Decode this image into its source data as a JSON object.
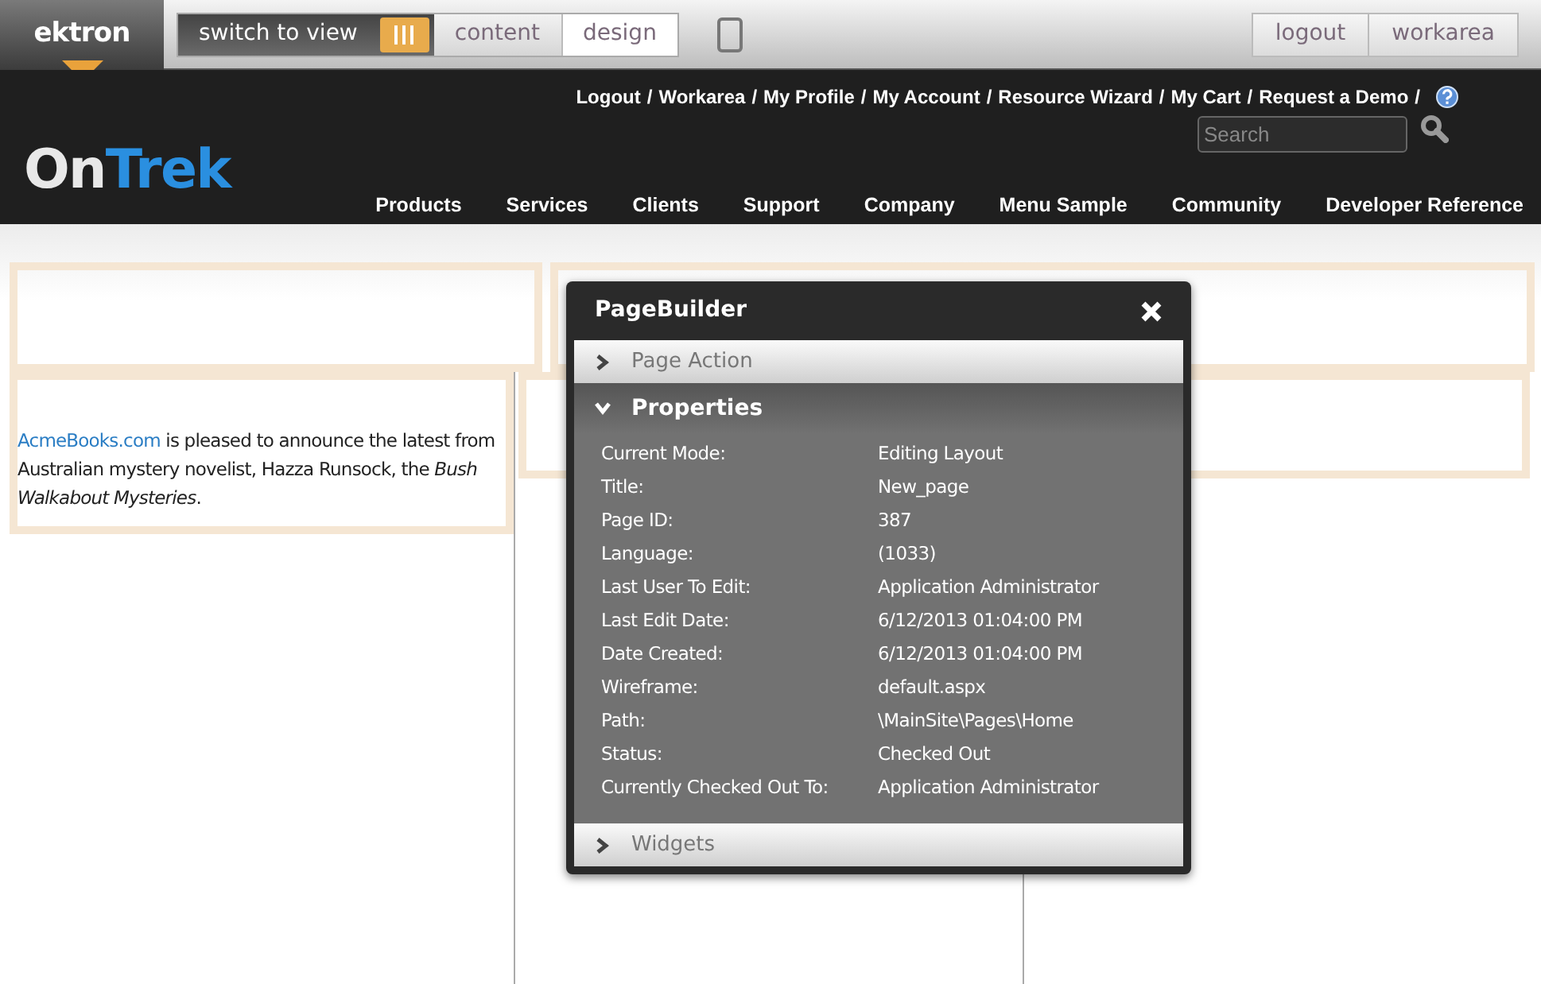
{
  "toolbar": {
    "logo": "ektron",
    "switch_label": "switch to view",
    "modes": [
      {
        "label": "content",
        "selected": false
      },
      {
        "label": "design",
        "selected": true
      }
    ],
    "buttons": [
      "logout",
      "workarea"
    ]
  },
  "header": {
    "utility_links": [
      "Logout",
      "Workarea",
      "My Profile",
      "My Account",
      "Resource Wizard",
      "My Cart",
      "Request a Demo"
    ],
    "separator": "/",
    "search": {
      "placeholder": "Search"
    },
    "logo": {
      "first": "On",
      "second": "Trek"
    },
    "nav": [
      "Products",
      "Services",
      "Clients",
      "Support",
      "Company",
      "Menu Sample",
      "Community",
      "Developer Reference"
    ]
  },
  "article": {
    "link": "AcmeBooks.com",
    "text": " is pleased to announce the latest from Australian mystery novelist, Hazza Runsock, the *Bush Walkabout Mysteries*."
  },
  "dialog": {
    "title": "PageBuilder",
    "sections": [
      {
        "label": "Page Action",
        "expanded": false
      },
      {
        "label": "Properties",
        "expanded": true,
        "properties": [
          {
            "label": "Current Mode:",
            "value": "Editing Layout"
          },
          {
            "label": "Title:",
            "value": "New_page"
          },
          {
            "label": "Page ID:",
            "value": "387"
          },
          {
            "label": "Language:",
            "value": "(1033)"
          },
          {
            "label": "Last User To Edit:",
            "value": "Application Administrator"
          },
          {
            "label": "Last Edit Date:",
            "value": "6/12/2013 01:04:00 PM"
          },
          {
            "label": "Date Created:",
            "value": "6/12/2013 01:04:00 PM"
          },
          {
            "label": "Wireframe:",
            "value": "default.aspx"
          },
          {
            "label": "Path:",
            "value": "\\MainSite\\Pages\\Home"
          },
          {
            "label": "Status:",
            "value": "Checked Out"
          },
          {
            "label": "Currently Checked Out To:",
            "value": "Application Administrator"
          }
        ]
      },
      {
        "label": "Widgets",
        "expanded": false
      }
    ]
  }
}
